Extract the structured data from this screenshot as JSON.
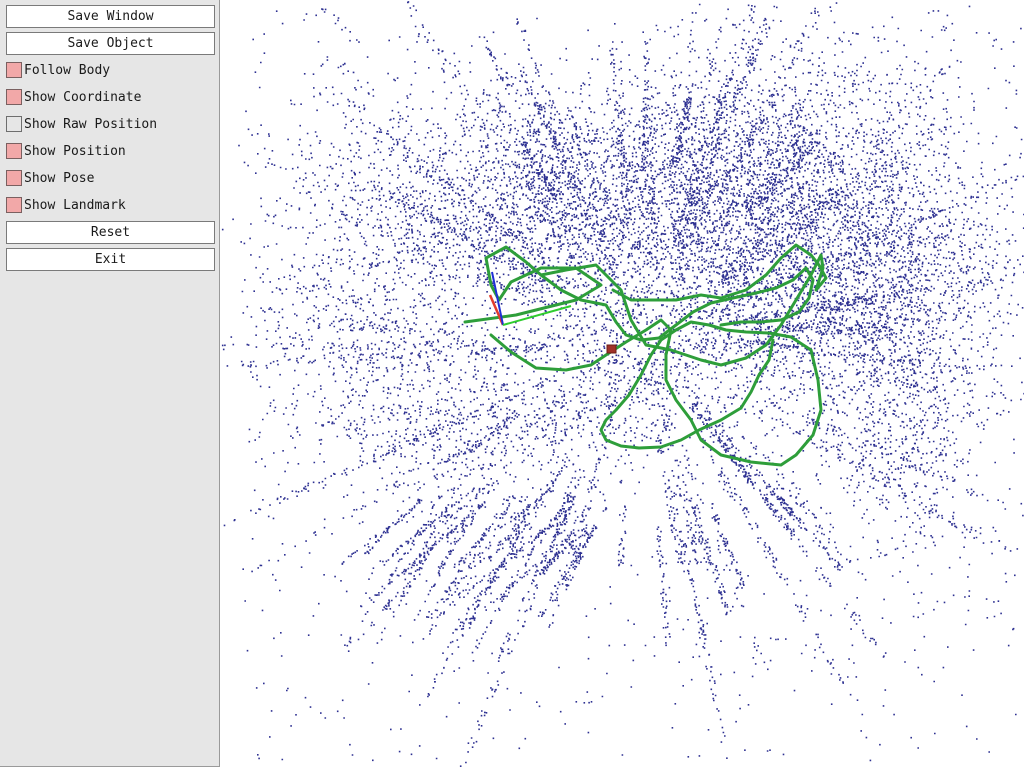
{
  "panel": {
    "save_window": "Save Window",
    "save_object": "Save Object",
    "follow_body": {
      "label": "Follow Body",
      "checked": true
    },
    "show_coordinate": {
      "label": "Show Coordinate",
      "checked": true
    },
    "show_raw_position": {
      "label": "Show Raw Position",
      "checked": false
    },
    "show_position": {
      "label": "Show Position",
      "checked": true
    },
    "show_pose": {
      "label": "Show Pose",
      "checked": true
    },
    "show_landmark": {
      "label": "Show Landmark",
      "checked": true
    },
    "reset": "Reset",
    "exit": "Exit"
  },
  "colors": {
    "panel_bg": "#e6e6e6",
    "checkbox_on": "#f2a8a8",
    "landmark": "#2e3192",
    "trajectory": "#2e9e3a",
    "axis_x": "#e23b2e",
    "axis_y": "#2ecc2e",
    "axis_z": "#1f2fd6",
    "marker": "#a0322a"
  },
  "icons": {
    "checkbox": "checkbox-square",
    "pose": "camera-frustum-axes",
    "marker": "current-position-square"
  }
}
